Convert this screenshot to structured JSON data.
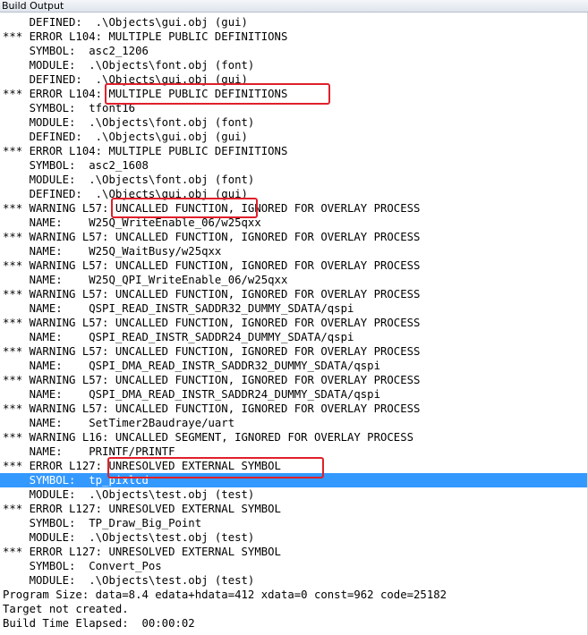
{
  "window": {
    "title": "Build Output"
  },
  "output": {
    "selected_index": 32,
    "lines": [
      "    DEFINED:  .\\Objects\\gui.obj (gui)",
      "*** ERROR L104: MULTIPLE PUBLIC DEFINITIONS",
      "    SYMBOL:  asc2_1206",
      "    MODULE:  .\\Objects\\font.obj (font)",
      "    DEFINED:  .\\Objects\\gui.obj (gui)",
      "*** ERROR L104: MULTIPLE PUBLIC DEFINITIONS",
      "    SYMBOL:  tfont16",
      "    MODULE:  .\\Objects\\font.obj (font)",
      "    DEFINED:  .\\Objects\\gui.obj (gui)",
      "*** ERROR L104: MULTIPLE PUBLIC DEFINITIONS",
      "    SYMBOL:  asc2_1608",
      "    MODULE:  .\\Objects\\font.obj (font)",
      "    DEFINED:  .\\Objects\\gui.obj (gui)",
      "*** WARNING L57: UNCALLED FUNCTION, IGNORED FOR OVERLAY PROCESS",
      "    NAME:    W25Q_WriteEnable_06/w25qxx",
      "*** WARNING L57: UNCALLED FUNCTION, IGNORED FOR OVERLAY PROCESS",
      "    NAME:    W25Q_WaitBusy/w25qxx",
      "*** WARNING L57: UNCALLED FUNCTION, IGNORED FOR OVERLAY PROCESS",
      "    NAME:    W25Q_QPI_WriteEnable_06/w25qxx",
      "*** WARNING L57: UNCALLED FUNCTION, IGNORED FOR OVERLAY PROCESS",
      "    NAME:    QSPI_READ_INSTR_SADDR32_DUMMY_SDATA/qspi",
      "*** WARNING L57: UNCALLED FUNCTION, IGNORED FOR OVERLAY PROCESS",
      "    NAME:    QSPI_READ_INSTR_SADDR24_DUMMY_SDATA/qspi",
      "*** WARNING L57: UNCALLED FUNCTION, IGNORED FOR OVERLAY PROCESS",
      "    NAME:    QSPI_DMA_READ_INSTR_SADDR32_DUMMY_SDATA/qspi",
      "*** WARNING L57: UNCALLED FUNCTION, IGNORED FOR OVERLAY PROCESS",
      "    NAME:    QSPI_DMA_READ_INSTR_SADDR24_DUMMY_SDATA/qspi",
      "*** WARNING L57: UNCALLED FUNCTION, IGNORED FOR OVERLAY PROCESS",
      "    NAME:    SetTimer2Baudraye/uart",
      "*** WARNING L16: UNCALLED SEGMENT, IGNORED FOR OVERLAY PROCESS",
      "    NAME:    PRINTF/PRINTF",
      "*** ERROR L127: UNRESOLVED EXTERNAL SYMBOL",
      "    SYMBOL:  tp_pixlcd",
      "    MODULE:  .\\Objects\\test.obj (test)",
      "*** ERROR L127: UNRESOLVED EXTERNAL SYMBOL",
      "    SYMBOL:  TP_Draw_Big_Point",
      "    MODULE:  .\\Objects\\test.obj (test)",
      "*** ERROR L127: UNRESOLVED EXTERNAL SYMBOL",
      "    SYMBOL:  Convert_Pos",
      "    MODULE:  .\\Objects\\test.obj (test)",
      "Program Size: data=8.4 edata+hdata=412 xdata=0 const=962 code=25182",
      "Target not created.",
      "Build Time Elapsed:  00:00:02"
    ]
  },
  "annotations": {
    "color": "#e0202a",
    "highlighted_phrases": [
      "MULTIPLE PUBLIC DEFINITIONS",
      "UNCALLED FUNCTION,",
      "UNRESOLVED EXTERNAL SYMBOL"
    ]
  }
}
